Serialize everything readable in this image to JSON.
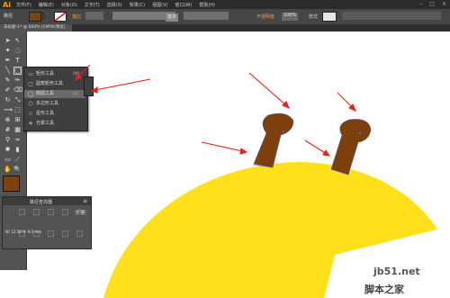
{
  "app": {
    "logo": "Ai"
  },
  "menubar": {
    "items": [
      "文件(F)",
      "编辑(E)",
      "对象(O)",
      "文字(T)",
      "选择(S)",
      "效果(C)",
      "视图(V)",
      "窗口(W)",
      "帮助(H)"
    ]
  },
  "optionsbar": {
    "selection_label": "路径",
    "stroke_label": "描边",
    "stroke_style": "基本",
    "opacity_label": "不透明度",
    "opacity_value": "100%",
    "style_label": "样式"
  },
  "document_tab": {
    "label": "未标题-1* @ 600% (CMYK/预览)"
  },
  "tool_flyout": {
    "items": [
      {
        "icon": "rectangle-icon",
        "label": "矩形工具",
        "shortcut": "(M)"
      },
      {
        "icon": "rounded-rectangle-icon",
        "label": "圆角矩形工具",
        "shortcut": ""
      },
      {
        "icon": "ellipse-icon",
        "label": "椭圆工具",
        "shortcut": "(L)"
      },
      {
        "icon": "polygon-icon",
        "label": "多边形工具",
        "shortcut": ""
      },
      {
        "icon": "star-icon",
        "label": "星形工具",
        "shortcut": ""
      },
      {
        "icon": "flare-icon",
        "label": "光晕工具",
        "shortcut": ""
      }
    ]
  },
  "panel": {
    "title": "路径查找器",
    "expand_label": "扩展",
    "size_text": "W: 12.58  H: 9.5 mm"
  },
  "colors": {
    "fill": "#7a4410",
    "giraffe_head": "#ffe01a",
    "horn": "#7d3f0c",
    "arrow": "#e8211b",
    "ui_dark": "#535353"
  },
  "watermark": {
    "line1": "jb51.net",
    "line2": "脚本之家"
  }
}
